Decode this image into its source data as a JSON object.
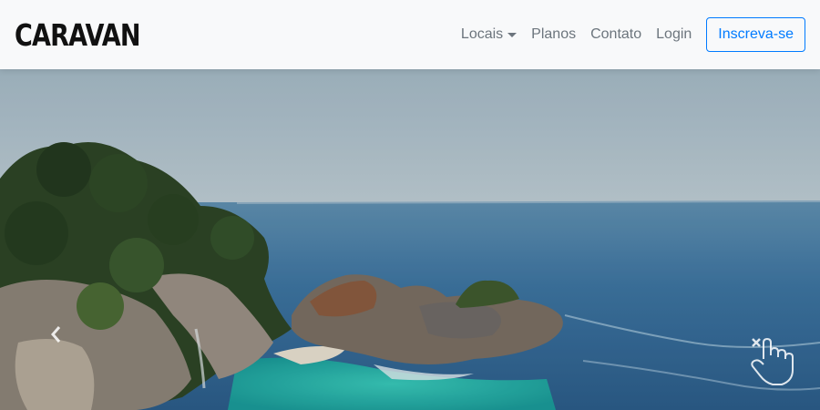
{
  "brand": {
    "name": "CARAVAN"
  },
  "nav": {
    "locais": "Locais",
    "planos": "Planos",
    "contato": "Contato",
    "login": "Login",
    "signup": "Inscreva-se"
  },
  "hero": {
    "icons": {
      "prev": "chevron-left-icon",
      "gesture": "swipe-hand-icon"
    }
  },
  "colors": {
    "primary": "#007bff",
    "nav_text": "#6c757d",
    "navbar_bg": "#f8f9fa"
  }
}
